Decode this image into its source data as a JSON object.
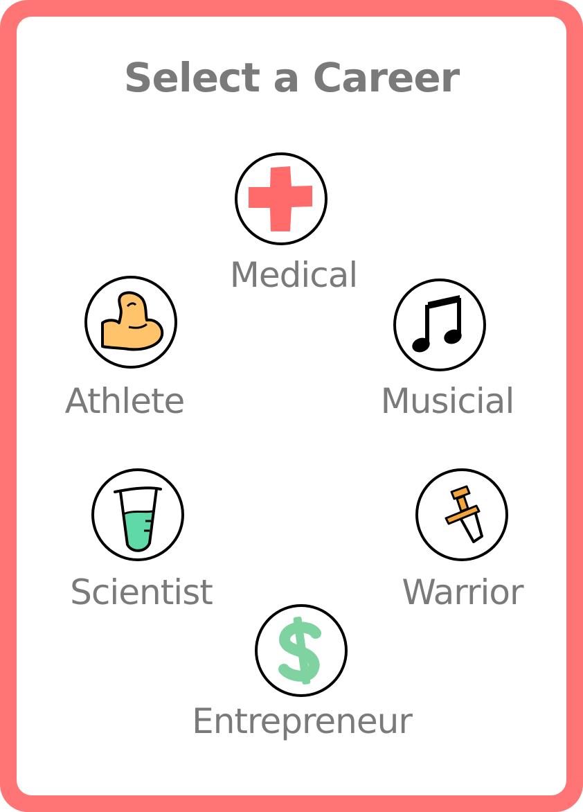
{
  "title": "Select a Career",
  "colors": {
    "frame": "#ff7474",
    "text": "#7a7a7a"
  },
  "careers": [
    {
      "id": "medical",
      "label": "Medical",
      "icon": "red-cross-icon"
    },
    {
      "id": "athlete",
      "label": "Athlete",
      "icon": "flexed-bicep-icon"
    },
    {
      "id": "musician",
      "label": "Musicial",
      "icon": "music-note-icon"
    },
    {
      "id": "scientist",
      "label": "Scientist",
      "icon": "test-tube-icon"
    },
    {
      "id": "warrior",
      "label": "Warrior",
      "icon": "sword-icon"
    },
    {
      "id": "entrepreneur",
      "label": "Entrepreneur",
      "icon": "dollar-sign-icon"
    }
  ]
}
